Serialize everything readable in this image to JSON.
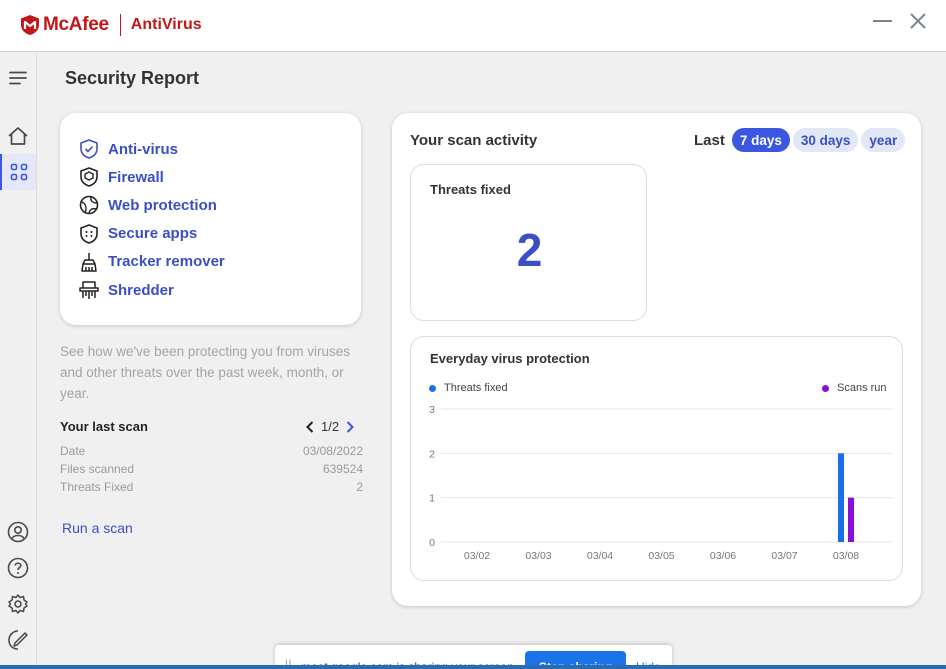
{
  "header": {
    "brand": "McAfee",
    "product": "AntiVirus",
    "colors": {
      "brand": "#c01818",
      "accent": "#3b56e0"
    },
    "window_controls": [
      "minimize-icon",
      "close-icon"
    ]
  },
  "sidebar": {
    "items": [
      {
        "icon": "menu-icon"
      },
      {
        "icon": "home-icon"
      },
      {
        "icon": "dashboard-icon",
        "active": true
      }
    ],
    "bottom_items": [
      {
        "icon": "account-icon"
      },
      {
        "icon": "help-icon"
      },
      {
        "icon": "settings-icon"
      },
      {
        "icon": "feedback-icon"
      }
    ]
  },
  "page": {
    "title": "Security Report"
  },
  "features": [
    {
      "label": "Anti-virus",
      "icon": "shield-check-icon"
    },
    {
      "label": "Firewall",
      "icon": "firewall-icon"
    },
    {
      "label": "Web protection",
      "icon": "globe-icon"
    },
    {
      "label": "Secure apps",
      "icon": "secure-apps-icon"
    },
    {
      "label": "Tracker remover",
      "icon": "broom-icon"
    },
    {
      "label": "Shredder",
      "icon": "shredder-icon"
    }
  ],
  "description": "See how we've been protecting you from viruses and other threats over the past week, month, or year.",
  "last_scan": {
    "title": "Your last scan",
    "page": "1/2",
    "rows": [
      {
        "label": "Date",
        "value": "03/08/2022"
      },
      {
        "label": "Files scanned",
        "value": "639524"
      },
      {
        "label": "Threats Fixed",
        "value": "2"
      }
    ],
    "run_label": "Run a scan"
  },
  "activity": {
    "title": "Your scan activity",
    "range_label": "Last",
    "ranges": [
      "7 days",
      "30 days",
      "year"
    ],
    "selected_range": "7 days",
    "threats_fixed": {
      "label": "Threats fixed",
      "value": "2"
    },
    "everyday": {
      "title": "Everyday virus protection"
    }
  },
  "chart_data": {
    "type": "bar",
    "title": "Everyday virus protection",
    "categories": [
      "03/02",
      "03/03",
      "03/04",
      "03/05",
      "03/06",
      "03/07",
      "03/08"
    ],
    "series": [
      {
        "name": "Threats fixed",
        "color": "#1a6fe8",
        "values": [
          0,
          0,
          0,
          0,
          0,
          0,
          2
        ]
      },
      {
        "name": "Scans run",
        "color": "#8a0fd6",
        "values": [
          0,
          0,
          0,
          0,
          0,
          0,
          1
        ]
      }
    ],
    "yticks": [
      0,
      1,
      2,
      3
    ],
    "ylim": [
      0,
      3
    ],
    "grid": true,
    "legend": "top"
  },
  "sharing_bar": {
    "grip": "||",
    "text": "meet.google.com is sharing your screen.",
    "stop_label": "Stop sharing",
    "hide_label": "Hide"
  }
}
